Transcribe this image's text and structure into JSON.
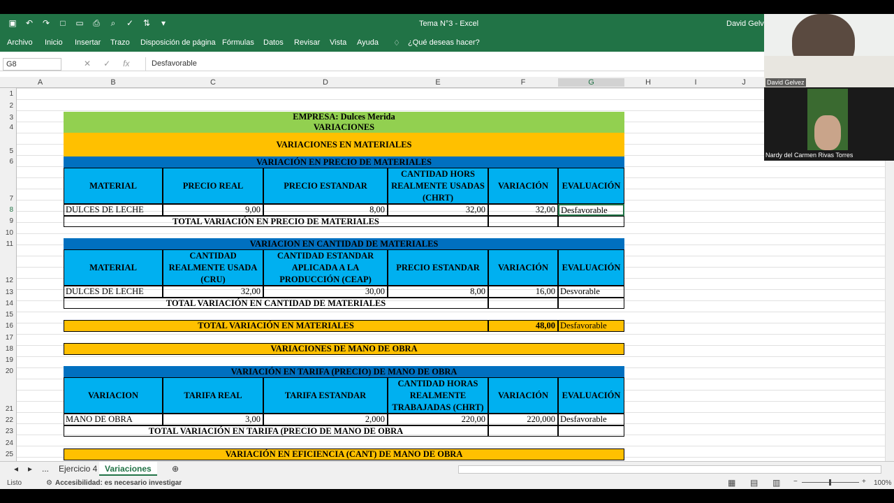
{
  "window": {
    "title": "Tema N°3  -  Excel",
    "user": "David Gelvez"
  },
  "ribbon": [
    "Archivo",
    "Inicio",
    "Insertar",
    "Trazo",
    "Disposición de página",
    "Fórmulas",
    "Datos",
    "Revisar",
    "Vista",
    "Ayuda",
    "¿Qué deseas hacer?"
  ],
  "formula_bar": {
    "name_box": "G8",
    "value": "Desfavorable"
  },
  "columns": [
    "A",
    "B",
    "C",
    "D",
    "E",
    "F",
    "G",
    "H",
    "I",
    "J"
  ],
  "rows": [
    "1",
    "2",
    "3",
    "4",
    "5",
    "6",
    "7",
    "8",
    "9",
    "10",
    "11",
    "12",
    "13",
    "14",
    "15",
    "16",
    "17",
    "18",
    "19",
    "20",
    "21",
    "22",
    "23",
    "24",
    "25"
  ],
  "sheet": {
    "empresa": "EMPRESA: Dulces Merida",
    "variaciones": "VARIACIONES",
    "var_materiales": "VARIACIONES EN MATERIALES",
    "s1": {
      "title": "VARIACIÓN EN PRECIO DE MATERIALES",
      "headers": [
        "MATERIAL",
        "PRECIO REAL",
        "PRECIO ESTANDAR",
        "CANTIDAD HORS REALMENTE USADAS (CHRT)",
        "VARIACIÓN",
        "EVALUACIÓN"
      ],
      "row": [
        "DULCES DE LECHE",
        "9,00",
        "8,00",
        "32,00",
        "32,00",
        "Desfavorable"
      ],
      "total": "TOTAL VARIACIÓN EN PRECIO DE MATERIALES"
    },
    "s2": {
      "title": "VARIACION EN CANTIDAD DE MATERIALES",
      "headers": [
        "MATERIAL",
        "CANTIDAD REALMENTE USADA (CRU)",
        "CANTIDAD ESTANDAR APLICADA A LA PRODUCCIÓN (CEAP)",
        "PRECIO ESTANDAR",
        "VARIACIÓN",
        "EVALUACIÓN"
      ],
      "row": [
        "DULCES DE LECHE",
        "32,00",
        "30,00",
        "8,00",
        "16,00",
        "Desvorable"
      ],
      "total": "TOTAL VARIACIÓN EN CANTIDAD DE MATERIALES"
    },
    "total_materiales": {
      "label": "TOTAL VARIACIÓN EN MATERIALES",
      "value": "48,00",
      "eval": "Desfavorable"
    },
    "mano_obra": "VARIACIONES DE MANO DE OBRA",
    "s3": {
      "title": "VARIACIÓN EN TARIFA (PRECIO) DE MANO DE OBRA",
      "headers": [
        "VARIACION",
        "TARIFA REAL",
        "TARIFA ESTANDAR",
        "CANTIDAD HORAS REALMENTE TRABAJADAS (CHRT)",
        "VARIACIÓN",
        "EVALUACIÓN"
      ],
      "row": [
        "MANO DE OBRA",
        "3,00",
        "2,000",
        "220,00",
        "220,000",
        "Desfavorable"
      ],
      "total": "TOTAL VARIACIÓN EN TARIFA (PRECIO DE MANO DE OBRA"
    },
    "s4_title": "VARIACIÓN EN EFICIENCIA (CANT) DE MANO DE OBRA"
  },
  "tabs": [
    "...",
    "Ejercicio 4",
    "Variaciones"
  ],
  "status": {
    "ready": "Listo",
    "accessibility": "Accesibilidad: es necesario investigar",
    "zoom": "100%"
  },
  "video": {
    "p1": "David Gelvez",
    "p2": "Nardy del Carmen Rivas Torres"
  }
}
